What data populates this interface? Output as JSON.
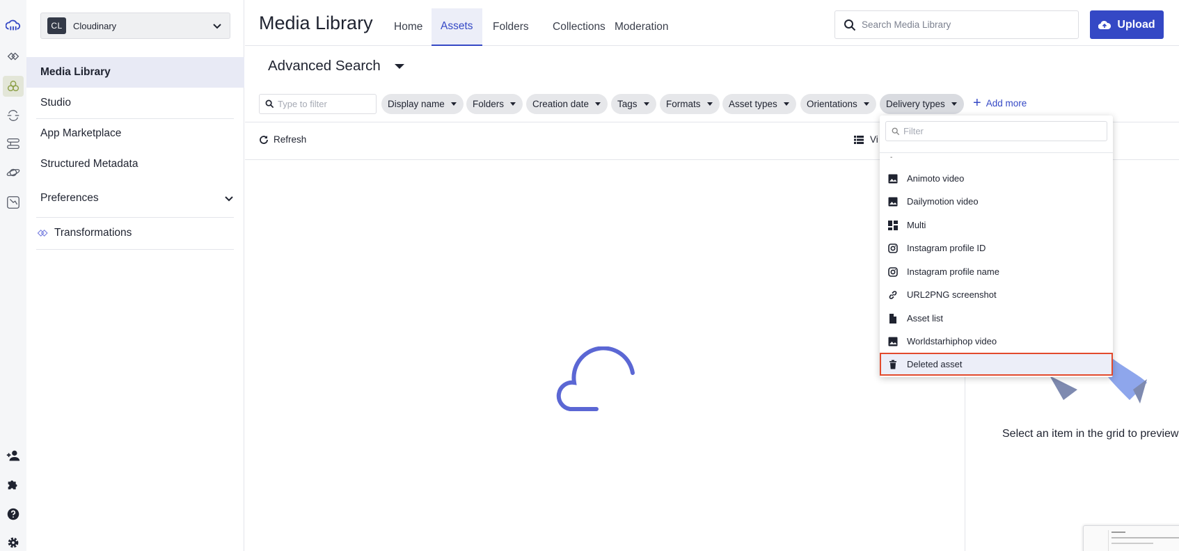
{
  "account": {
    "badge": "CL",
    "name": "Cloudinary"
  },
  "sidebar": {
    "items": [
      {
        "label": "Media Library"
      },
      {
        "label": "Studio"
      },
      {
        "label": "App Marketplace"
      },
      {
        "label": "Structured Metadata"
      },
      {
        "label": "Preferences"
      },
      {
        "label": "Transformations"
      }
    ]
  },
  "header": {
    "title": "Media Library",
    "tabs": [
      {
        "label": "Home"
      },
      {
        "label": "Assets"
      },
      {
        "label": "Folders"
      },
      {
        "label": "Collections"
      },
      {
        "label": "Moderation"
      }
    ],
    "search_placeholder": "Search Media Library",
    "upload_label": "Upload"
  },
  "advanced": {
    "title": "Advanced Search",
    "filter_placeholder": "Type to filter",
    "chips": [
      {
        "label": "Display name"
      },
      {
        "label": "Folders"
      },
      {
        "label": "Creation date"
      },
      {
        "label": "Tags"
      },
      {
        "label": "Formats"
      },
      {
        "label": "Asset types"
      },
      {
        "label": "Orientations"
      },
      {
        "label": "Delivery types"
      }
    ],
    "add_more": "Add more"
  },
  "toolbar": {
    "refresh": "Refresh",
    "view": "Vi"
  },
  "preview": {
    "text": "Select an item in the grid to preview i"
  },
  "dropdown": {
    "filter_placeholder": "Filter",
    "items": [
      {
        "label": "Animoto video",
        "icon": "image-icon"
      },
      {
        "label": "Dailymotion video",
        "icon": "image-icon"
      },
      {
        "label": "Multi",
        "icon": "dashboard-icon"
      },
      {
        "label": "Instagram profile ID",
        "icon": "instagram-icon"
      },
      {
        "label": "Instagram profile name",
        "icon": "instagram-icon"
      },
      {
        "label": "URL2PNG screenshot",
        "icon": "link-icon"
      },
      {
        "label": "Asset list",
        "icon": "file-icon"
      },
      {
        "label": "Worldstarhiphop video",
        "icon": "image-icon"
      },
      {
        "label": "Deleted asset",
        "icon": "trash-icon"
      }
    ]
  },
  "colors": {
    "accent": "#3448c5",
    "highlight": "#e24a2d"
  }
}
